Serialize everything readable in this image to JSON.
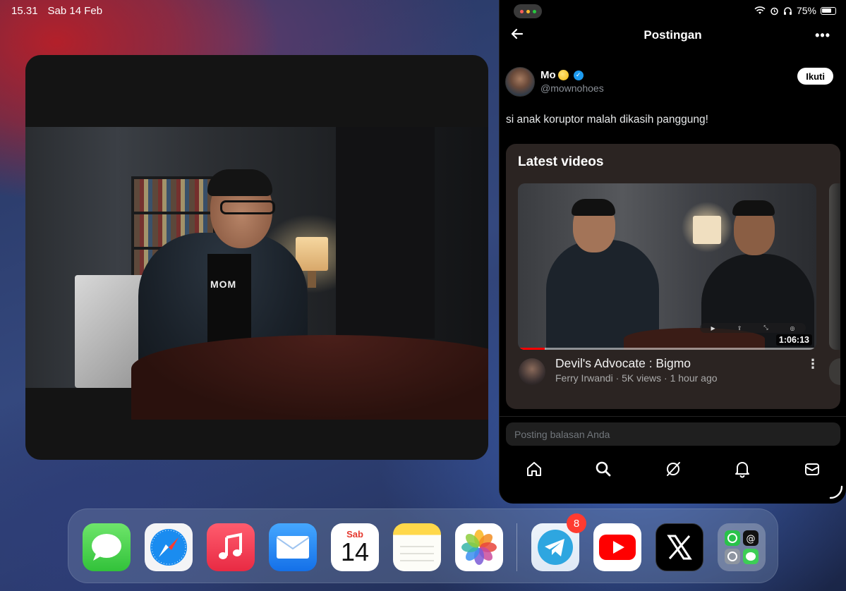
{
  "status_bar": {
    "time": "15.31",
    "date": "Sab 14 Feb",
    "battery": "75%"
  },
  "video_window": {
    "shirt_text": "MOM"
  },
  "x_app": {
    "header_title": "Postingan",
    "author": {
      "name": "Mo",
      "handle": "@mownohoes",
      "follow_label": "Ikuti"
    },
    "post_text": "si anak koruptor malah dikasih panggung!",
    "card": {
      "title": "Latest videos",
      "video": {
        "title": "Devil's Advocate : Bigmo",
        "meta": "Ferry Irwandi · 5K views · 1 hour ago",
        "duration": "1:06:13",
        "progress": 0.09
      }
    },
    "reply_placeholder": "Posting balasan Anda",
    "tabs": [
      "home-icon",
      "search-icon",
      "grok-icon",
      "notifications-icon",
      "messages-icon"
    ]
  },
  "dock": {
    "apps": [
      "Messages",
      "Safari",
      "Music",
      "Mail",
      "Calendar",
      "Notes",
      "Photos",
      "Telegram",
      "YouTube",
      "X",
      "App Library"
    ],
    "calendar_day": "Sab",
    "calendar_date": "14",
    "telegram_badge": "8"
  },
  "colors": {
    "accent_verified": "#1d9bf0",
    "youtube_red": "#ff0000",
    "badge_red": "#ff3b30",
    "card_bg": "#2b2422"
  }
}
